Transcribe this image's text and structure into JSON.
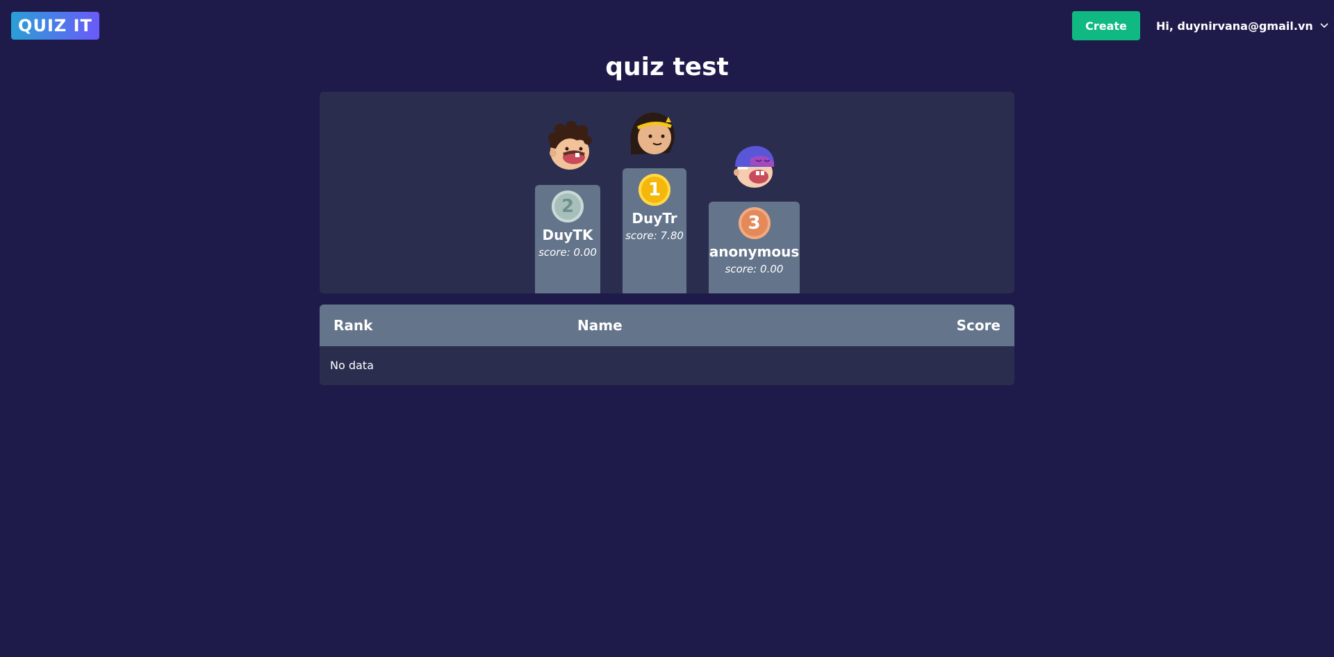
{
  "header": {
    "logo_text": "QUIZ IT",
    "create_label": "Create",
    "user_greeting": "Hi, duynirvana@gmail.vn"
  },
  "page": {
    "title": "quiz test"
  },
  "podium": [
    {
      "rank": "2",
      "name": "DuyTK",
      "score": "score: 0.00"
    },
    {
      "rank": "1",
      "name": "DuyTr",
      "score": "score: 7.80"
    },
    {
      "rank": "3",
      "name": "anonymous",
      "score": "score: 0.00"
    }
  ],
  "leaderboard": {
    "columns": [
      "Rank",
      "Name",
      "Score"
    ],
    "empty_text": "No data"
  },
  "colors": {
    "background": "#1e1b4b",
    "panel": "#2a2d4e",
    "podium_stand": "#64748b",
    "create_button": "#10b981",
    "logo_gradient_start": "#2a9fd6",
    "logo_gradient_end": "#6a5af9",
    "gold": "#f5b70a",
    "silver": "#a7bfbb",
    "bronze": "#e4895a"
  }
}
